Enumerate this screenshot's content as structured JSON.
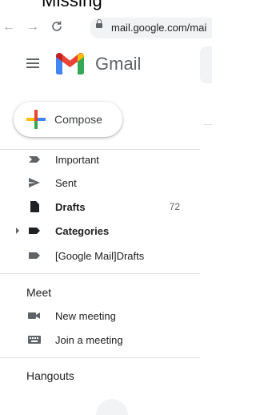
{
  "browser": {
    "caption_partial": "Missing",
    "url": "mail.google.com/mai",
    "back_icon": "arrow-left-icon",
    "forward_icon": "arrow-right-icon",
    "reload_icon": "reload-icon"
  },
  "header": {
    "menu_icon": "hamburger-icon",
    "logo_text": "Gmail"
  },
  "compose": {
    "label": "Compose"
  },
  "nav": {
    "items": [
      {
        "label": "Important",
        "icon": "important-icon",
        "bold": false,
        "count": ""
      },
      {
        "label": "Sent",
        "icon": "send-icon",
        "bold": false,
        "count": ""
      },
      {
        "label": "Drafts",
        "icon": "draft-icon",
        "bold": true,
        "count": "72"
      },
      {
        "label": "Categories",
        "icon": "label-icon",
        "bold": true,
        "count": ""
      },
      {
        "label": "[Google Mail]Drafts",
        "icon": "label-icon",
        "bold": false,
        "count": ""
      }
    ]
  },
  "meet": {
    "title": "Meet",
    "items": [
      {
        "label": "New meeting",
        "icon": "video-camera-icon"
      },
      {
        "label": "Join a meeting",
        "icon": "keyboard-icon"
      }
    ]
  },
  "hangouts": {
    "title": "Hangouts"
  },
  "colors": {
    "icon_gray": "#5f6368",
    "gmail_red": "#ea4335",
    "gmail_blue": "#4285f4",
    "gmail_green": "#34a853",
    "gmail_yellow": "#fbbc04"
  }
}
